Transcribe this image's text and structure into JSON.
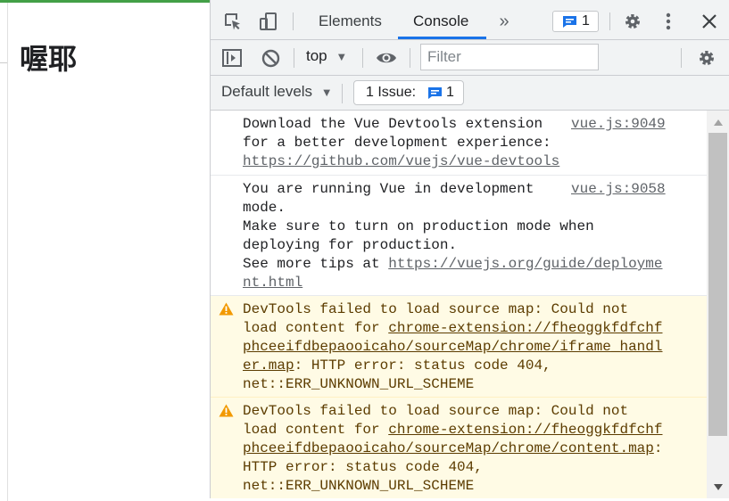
{
  "page": {
    "heading": "喔耶"
  },
  "devtools": {
    "tabs": [
      {
        "label": "Elements",
        "active": false
      },
      {
        "label": "Console",
        "active": true
      }
    ],
    "more_tabs_icon": "chevron-double-right-icon",
    "message_count": "1",
    "context": "top",
    "filter_placeholder": "Filter",
    "default_levels": "Default levels",
    "issues_label": "1 Issue:",
    "issues_count": "1",
    "accent_color": "#1a73e8",
    "warning_color": "#fffbe5"
  },
  "console": {
    "messages": [
      {
        "level": "info",
        "source": "vue.js:9049",
        "lines": [
          {
            "text": "Download the Vue Devtools extension"
          },
          {
            "text": "for a better development experience:"
          },
          {
            "link": "https://github.com/vuejs/vue-devtools"
          }
        ]
      },
      {
        "level": "info",
        "source": "vue.js:9058",
        "lines": [
          {
            "text": "You are running Vue in development"
          },
          {
            "text": "mode."
          },
          {
            "text": "Make sure to turn on production mode when"
          },
          {
            "text": "deploying for production."
          },
          {
            "text": "See more tips at ",
            "link": "https://vuejs.org/guide/deployme"
          },
          {
            "link": "nt.html"
          }
        ]
      },
      {
        "level": "warning",
        "lines": [
          {
            "text": "DevTools failed to load source map: Could not"
          },
          {
            "text": "load content for ",
            "link": "chrome-extension://fheoggkfdfchf"
          },
          {
            "link": "phceeifdbepaooicaho/sourceMap/chrome/iframe_handl"
          },
          {
            "link": "er.map",
            "after": ": HTTP error: status code 404,"
          },
          {
            "text": "net::ERR_UNKNOWN_URL_SCHEME"
          }
        ]
      },
      {
        "level": "warning",
        "lines": [
          {
            "text": "DevTools failed to load source map: Could not"
          },
          {
            "text": "load content for ",
            "link": "chrome-extension://fheoggkfdfchf"
          },
          {
            "link": "phceeifdbepaooicaho/sourceMap/chrome/content.map",
            "after": ":"
          },
          {
            "text": "HTTP error: status code 404,"
          },
          {
            "text": "net::ERR_UNKNOWN_URL_SCHEME"
          }
        ]
      }
    ]
  }
}
